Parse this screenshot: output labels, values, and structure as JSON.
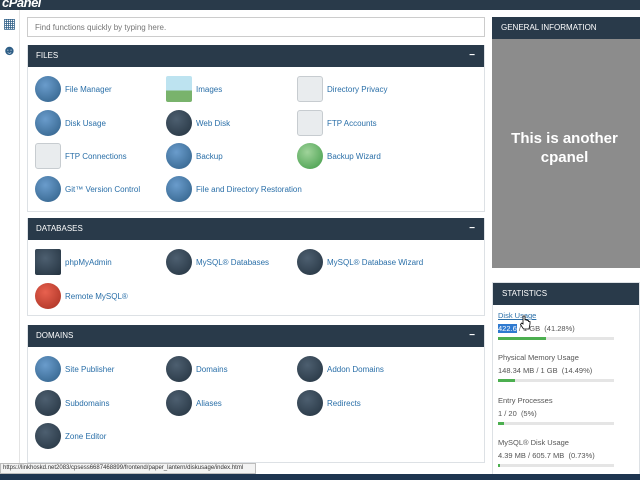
{
  "app": {
    "logo": "cPanel"
  },
  "search": {
    "placeholder": "Find functions quickly by typing here."
  },
  "sections": {
    "files": {
      "title": "FILES",
      "items": [
        "File Manager",
        "Images",
        "Directory Privacy",
        "Disk Usage",
        "Web Disk",
        "FTP Accounts",
        "FTP Connections",
        "Backup",
        "Backup Wizard",
        "Git™ Version Control",
        "File and Directory Restoration"
      ]
    },
    "databases": {
      "title": "DATABASES",
      "items": [
        "phpMyAdmin",
        "MySQL® Databases",
        "MySQL® Database Wizard",
        "Remote MySQL®"
      ]
    },
    "domains": {
      "title": "DOMAINS",
      "items": [
        "Site Publisher",
        "Domains",
        "Addon Domains",
        "Subdomains",
        "Aliases",
        "Redirects",
        "Zone Editor"
      ]
    }
  },
  "general_info": {
    "title": "GENERAL INFORMATION",
    "overlay_line1": "This is another",
    "overlay_line2": "cpanel"
  },
  "statistics": {
    "title": "STATISTICS",
    "items": [
      {
        "label": "Disk Usage",
        "used": "422.6",
        "rest": " / 1 GB",
        "percent": "(41.28%)",
        "fraction": 0.4128
      },
      {
        "label": "Physical Memory Usage",
        "used": "148.34 MB",
        "rest": " / 1 GB",
        "percent": "(14.49%)",
        "fraction": 0.1449
      },
      {
        "label": "Entry Processes",
        "used": "1",
        "rest": " / 20",
        "percent": "(5%)",
        "fraction": 0.05
      },
      {
        "label": "MySQL® Disk Usage",
        "used": "4.39 MB",
        "rest": " / 605.7 MB",
        "percent": "(0.73%)",
        "fraction": 0.0073
      }
    ]
  },
  "status_url": "https://linkhoskd.net2083/cpsess6687468899/frontend/paper_lantern/diskusage/index.html",
  "icons": {
    "collapse": "−",
    "grid": "▦",
    "users": "☻"
  },
  "colors": {
    "header": "#293a4a",
    "link": "#2a6fa8",
    "bar_fill": "#4caf50"
  }
}
